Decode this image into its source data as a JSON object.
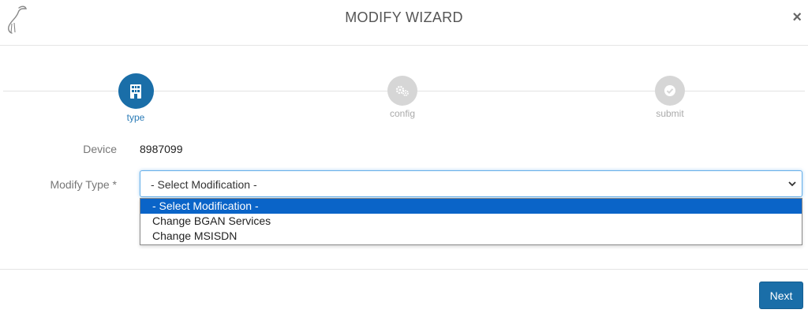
{
  "modal": {
    "title": "MODIFY WIZARD",
    "close_label": "×"
  },
  "wizard": {
    "steps": [
      {
        "label": "type",
        "icon": "building-icon",
        "state": "active"
      },
      {
        "label": "config",
        "icon": "gears-icon",
        "state": "inactive"
      },
      {
        "label": "submit",
        "icon": "check-circle-icon",
        "state": "inactive"
      }
    ]
  },
  "form": {
    "device": {
      "label": "Device",
      "value": "8987099"
    },
    "modify_type": {
      "label": "Modify Type *",
      "selected": "- Select Modification -",
      "options": [
        "- Select Modification -",
        "Change BGAN Services",
        "Change MSISDN"
      ]
    }
  },
  "footer": {
    "next_label": "Next"
  },
  "colors": {
    "primary": "#1a6ea8",
    "inactive_step": "#d6d6d6",
    "dropdown_highlight": "#0a64c8"
  }
}
